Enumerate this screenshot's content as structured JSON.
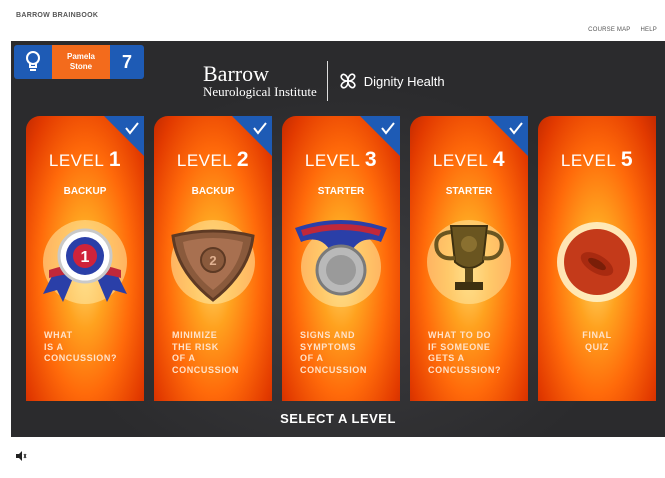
{
  "app": {
    "title": "BARROW BRAINBOOK"
  },
  "top_links": [
    {
      "label": "COURSE MAP"
    },
    {
      "label": "HELP"
    }
  ],
  "user": {
    "first_name": "Pamela",
    "last_name": "Stone",
    "count": "7",
    "icon": "lightbulb-icon"
  },
  "logo": {
    "barrow_line1": "Barrow",
    "barrow_line2": "Neurological Institute",
    "dignity": "Dignity Health"
  },
  "levels": [
    {
      "prefix": "LEVEL",
      "number": "1",
      "rank": "BACKUP",
      "desc": "WHAT\nIS A\nCONCUSSION?",
      "completed": true,
      "badge": "ribbon-medal-icon"
    },
    {
      "prefix": "LEVEL",
      "number": "2",
      "rank": "BACKUP",
      "desc": "MINIMIZE\nTHE RISK\nOF A\nCONCUSSION",
      "completed": true,
      "badge": "bronze-shield-icon"
    },
    {
      "prefix": "LEVEL",
      "number": "3",
      "rank": "STARTER",
      "desc": "SIGNS AND\nSYMPTOMS\nOF A\nCONCUSSION",
      "completed": true,
      "badge": "silver-medal-icon"
    },
    {
      "prefix": "LEVEL",
      "number": "4",
      "rank": "STARTER",
      "desc": "WHAT TO DO\nIF SOMEONE\nGETS A\nCONCUSSION?",
      "completed": true,
      "badge": "trophy-icon"
    },
    {
      "prefix": "LEVEL",
      "number": "5",
      "rank": "",
      "desc": "FINAL\nQUIZ",
      "completed": false,
      "badge": "ring-icon"
    }
  ],
  "select_label": "SELECT A LEVEL",
  "colors": {
    "accent_blue": "#1e5bb5",
    "accent_orange": "#f36b1c",
    "stage_bg": "#2b2b2d"
  }
}
